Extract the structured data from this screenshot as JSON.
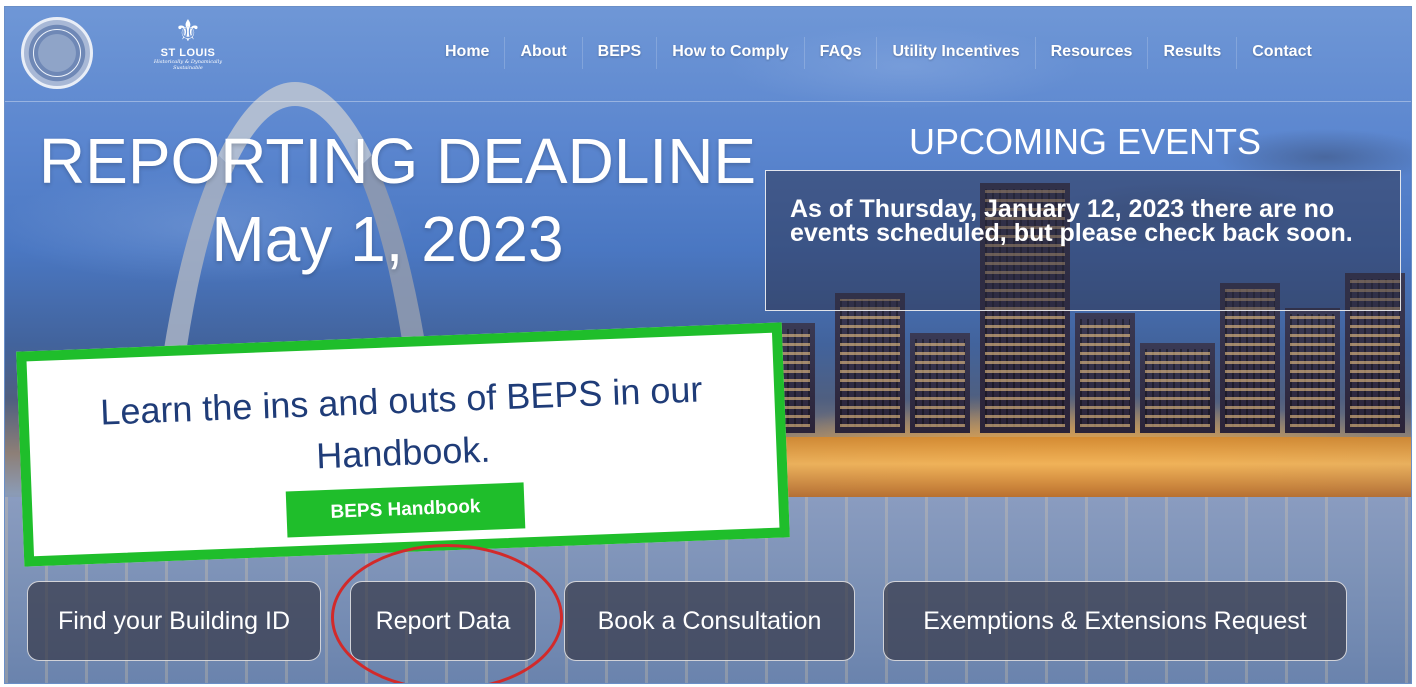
{
  "header": {
    "seal_logo": "city-seal-icon",
    "brand": {
      "name": "ST LOUIS",
      "tagline": "Historically & Dynamically Sustainable",
      "icon": "fleur-de-lis-icon"
    },
    "nav": [
      "Home",
      "About",
      "BEPS",
      "How to Comply",
      "FAQs",
      "Utility Incentives",
      "Resources",
      "Results",
      "Contact"
    ]
  },
  "hero": {
    "deadline_title": "REPORTING DEADLINE",
    "deadline_date": "May 1, 2023"
  },
  "events": {
    "title": "UPCOMING EVENTS",
    "message": "As of Thursday, January 12, 2023 there are no events scheduled, but please check back soon."
  },
  "handbook": {
    "text": "Learn the ins and outs of BEPS in our Handbook.",
    "button": "BEPS Handbook",
    "border_color": "#1fbe2b"
  },
  "actions": [
    "Find your Building ID",
    "Report Data",
    "Book a Consultation",
    "Exemptions & Extensions Request"
  ],
  "annotation": {
    "color": "#d22a2a"
  }
}
